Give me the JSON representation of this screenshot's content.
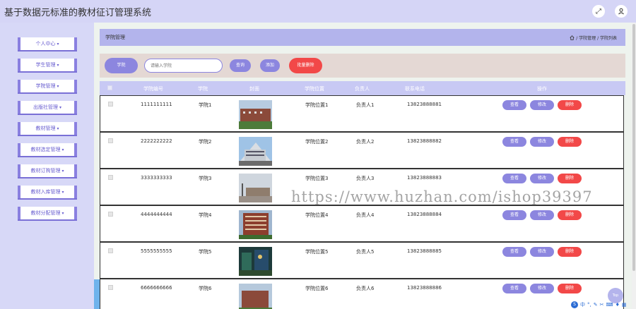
{
  "app": {
    "title": "基于数据元标准的教材征订管理系统"
  },
  "top_icons": {
    "fullscreen": "fullscreen-icon",
    "user": "user-icon"
  },
  "sidebar": {
    "items": [
      {
        "label": "个人中心"
      },
      {
        "label": "学生管理"
      },
      {
        "label": "学院管理"
      },
      {
        "label": "出版社管理"
      },
      {
        "label": "教材管理"
      },
      {
        "label": "教材选定管理"
      },
      {
        "label": "教材订购管理"
      },
      {
        "label": "教材入库管理"
      },
      {
        "label": "教材分配管理"
      }
    ]
  },
  "breadcrumb": {
    "title": "学院管理",
    "path": "/ 学院管理 / 学院列表"
  },
  "search": {
    "label": "学院",
    "placeholder": "请输入学院",
    "query_label": "查询",
    "add_label": "添加",
    "batch_delete_label": "批量删除"
  },
  "table": {
    "columns": [
      "学院编号",
      "学院",
      "封面",
      "学院位置",
      "负责人",
      "联系电话",
      "操作"
    ],
    "action_labels": {
      "view": "查看",
      "edit": "修改",
      "delete": "删除"
    },
    "rows": [
      {
        "id": "1111111111",
        "name": "学院1",
        "location": "学院位置1",
        "manager": "负责人1",
        "phone": "13823888881"
      },
      {
        "id": "2222222222",
        "name": "学院2",
        "location": "学院位置2",
        "manager": "负责人2",
        "phone": "13823888882"
      },
      {
        "id": "3333333333",
        "name": "学院3",
        "location": "学院位置3",
        "manager": "负责人3",
        "phone": "13823888883"
      },
      {
        "id": "4444444444",
        "name": "学院4",
        "location": "学院位置4",
        "manager": "负责人4",
        "phone": "13823888884"
      },
      {
        "id": "5555555555",
        "name": "学院5",
        "location": "学院位置5",
        "manager": "负责人5",
        "phone": "13823888885"
      },
      {
        "id": "6666666666",
        "name": "学院6",
        "location": "学院位置6",
        "manager": "负责人6",
        "phone": "13823888886"
      }
    ]
  },
  "watermark": "https://www.huzhan.com/ishop39397",
  "back_to_top": "Top",
  "colors": {
    "accent": "#8c86df",
    "danger": "#f24848",
    "header": "#d5d5f6",
    "sidebar": "#d7d8f7"
  }
}
